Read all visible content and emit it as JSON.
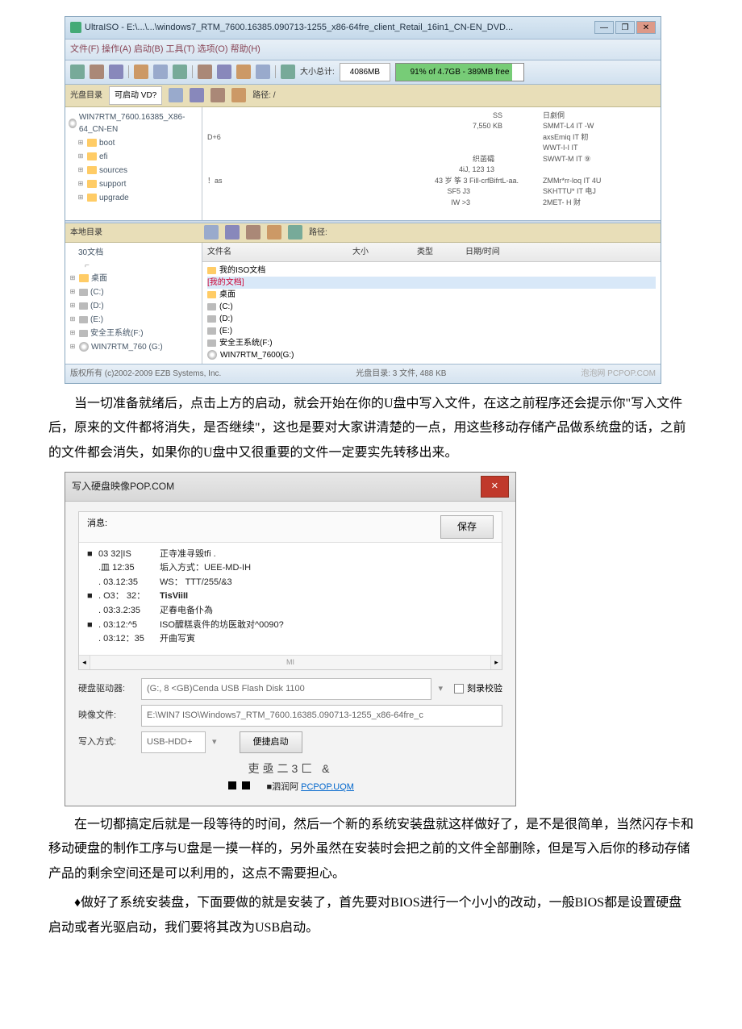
{
  "shot1": {
    "title": "UltraISO - E:\\...\\...\\windows7_RTM_7600.16385.090713-1255_x86-64fre_client_Retail_16in1_CN-EN_DVD...",
    "menu": "文件(F)   操作(A)   启动(B)   工具(T)   选项(O)   帮助(H)",
    "size_label": "大小总计:",
    "size_value": "4086MB",
    "progress_text": "91% of 4.7GB - 389MB free",
    "cd_label": "光盘目录",
    "bootable": "可启动 VD?",
    "path_label": "路径: /",
    "tree_root": "WIN7RTM_7600.16385_X86-64_CN-EN",
    "tree_items": [
      "boot",
      "efi",
      "sources",
      "support",
      "upgrade"
    ],
    "col_ss": "SS",
    "col_size": "7,550 KB",
    "col_d6": "D+6",
    "col_mid1": "织菡礵",
    "col_mid2": "4iJ, 123 13",
    "col_mid3": "43 岁 筝 3 Fill-crfBifrtL-aa.",
    "col_mid4": "SF5 J3",
    "col_mid5": "IW >3",
    "col_excl": "！as",
    "col_r0": "日劇侗",
    "col_r1": "SMMT-L4 IT -W",
    "col_r2": "axsEmiq IT 籾",
    "col_r3": "WWT-I-I IT",
    "col_r4": "SWWT-M IT ⑨",
    "col_r5": "ZMMr*rr-loq IT 4U",
    "col_r6": "SKHTTU* IT 电J",
    "col_r7": "2MET-   H        财",
    "local_label": "本地目录",
    "local_path": "路径:",
    "local_root": "30文档",
    "local_tree": [
      "桌面",
      "(C:)",
      "(D:)",
      "(E:)",
      "安全王系统(F:)",
      "WIN7RTM_760 (G:)"
    ],
    "list_h1": "文件名",
    "list_h2": "大小",
    "list_h3": "类型",
    "list_h4": "日期/时间",
    "list_items": [
      "我的ISO文档",
      "[我的文档]",
      "桌面",
      "(C:)",
      "(D:)",
      "(E:)",
      "安全王系统(F:)",
      "WIN7RTM_7600(G:)"
    ],
    "copyright": "版权所有 (c)2002-2009 EZB Systems, Inc.",
    "status_mid": "光盘目录: 3 文件, 488 KB",
    "watermark": "泡泡网  PCPOP.COM"
  },
  "para1": "当一切准备就绪后，点击上方的启动，就会开始在你的U盘中写入文件，在这之前程序还会提示你\"写入文件后，原来的文件都将消失，是否继续\"，这也是要对大家讲清楚的一点，用这些移动存储产品做系统盘的话，之前的文件都会消失，如果你的U盘中又很重要的文件一定要实先转移出来。",
  "shot2": {
    "title": "写入硬盘映像POP.COM",
    "msg_label": "消息:",
    "save_btn": "保存",
    "lines": [
      {
        "bullet": "■",
        "t": "03 32|IS",
        "txt": "正寺准寻毀tfi       ."
      },
      {
        "bullet": "",
        "t": ".皿 12:35",
        "txt": "垢入方式：UEE-MD-IH"
      },
      {
        "bullet": "",
        "t": ". 03.12:35",
        "txt": "WS： TTT/255/&3"
      },
      {
        "bullet": "■",
        "t": ". O3： 32：",
        "txt": "                       TisViiII"
      },
      {
        "bullet": "",
        "t": ". 03:3.2:35",
        "txt": "疋春电备仆為"
      },
      {
        "bullet": "■",
        "t": ". 03:12:^5",
        "txt": "ISO醾糕袁件的坊医敢对^0090?"
      },
      {
        "bullet": "",
        "t": ". 03:12：35",
        "txt": "开曲写寅"
      }
    ],
    "scroll_mid": "MI",
    "drive_label": "硬盘驱动器:",
    "drive_value": "(G:, 8 <GB)Cenda   USB Flash Disk  1100",
    "check_label": "刻录校验",
    "image_label": "映像文件:",
    "image_value": "E:\\WIN7 ISO\\Windows7_RTM_7600.16385.090713-1255_x86-64fre_c",
    "mode_label": "写入方式:",
    "mode_value": "USB-HDD+",
    "quick_btn": "便捷启动",
    "footer1": "吏亟二3匚   &",
    "footer2a": "■泗润阿",
    "footer2b": "PCPOP.UQM"
  },
  "para2": "在一切都搞定后就是一段等待的时间，然后一个新的系统安装盘就这样做好了，是不是很简单，当然闪存卡和移动硬盘的制作工序与U盘是一摸一样的，另外虽然在安装时会把之前的文件全部删除，但是写入后你的移动存储产品的剩余空间还是可以利用的，这点不需要担心。",
  "para3": "♦做好了系统安装盘，下面要做的就是安装了，首先要对BIOS进行一个小小的改动，一般BIOS都是设置硬盘启动或者光驱启动，我们要将其改为USB启动。"
}
